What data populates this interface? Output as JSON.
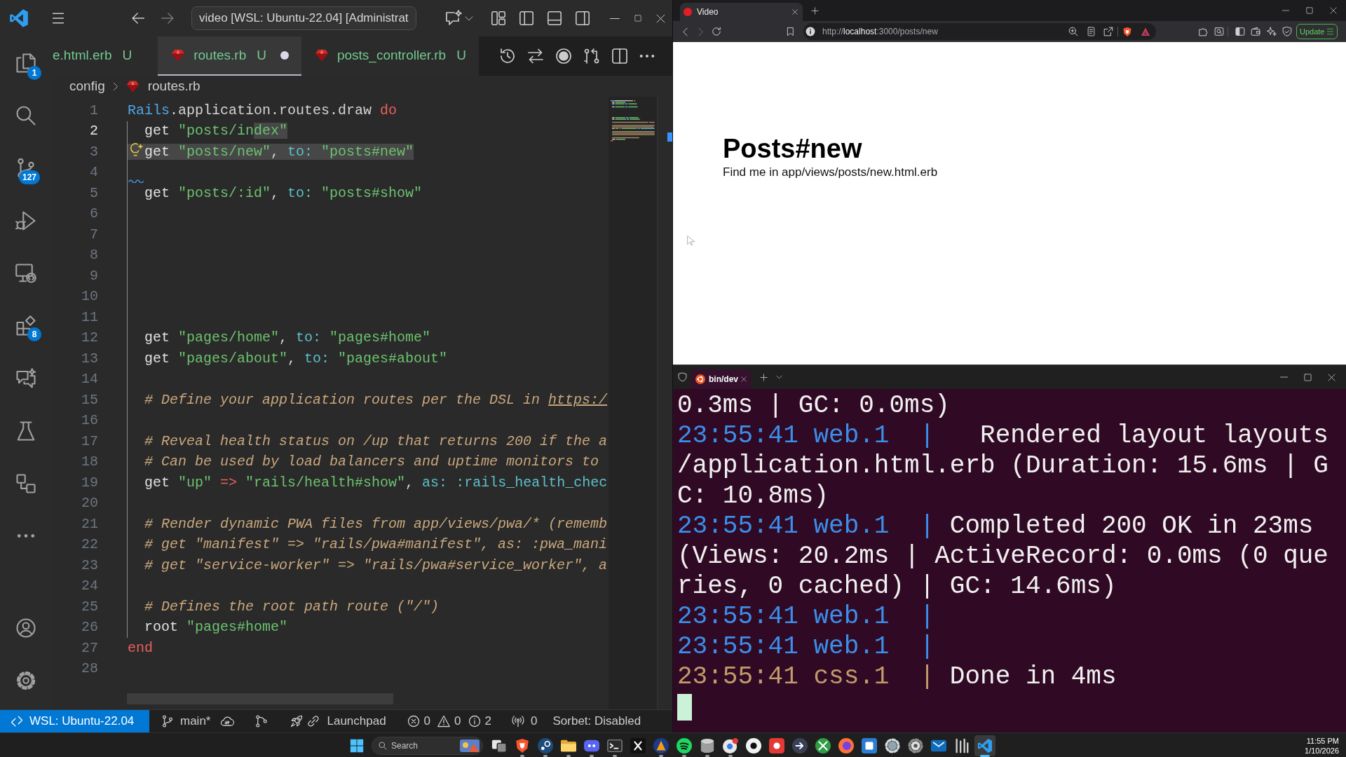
{
  "editor_window": {
    "command_center": "video [WSL: Ubuntu-22.04] [Administrat",
    "activity_bar": {
      "explorer_badge": "1",
      "source_control_badge": "127",
      "extensions_badge": "8"
    },
    "tabs": [
      {
        "label": "e.html.erb",
        "decoration": "U",
        "clipped": true,
        "selected": false,
        "dirty": false
      },
      {
        "label": "routes.rb",
        "decoration": "U",
        "clipped": false,
        "selected": true,
        "dirty": true
      },
      {
        "label": "posts_controller.rb",
        "decoration": "U",
        "clipped": false,
        "selected": false,
        "dirty": false
      }
    ],
    "breadcrumb": [
      {
        "label": "config",
        "kind": "folder"
      },
      {
        "label": "routes.rb",
        "kind": "file"
      }
    ],
    "lines": [
      {
        "number": "1",
        "current": false,
        "tokens": [
          {
            "kind": "constant",
            "text": "Rails",
            "selected": false
          },
          {
            "kind": "method",
            "text": ".application.routes.draw ",
            "selected": false
          },
          {
            "kind": "keyword",
            "text": "do",
            "selected": false
          }
        ]
      },
      {
        "number": "2",
        "current": true,
        "tokens": [
          {
            "kind": "plain",
            "text": "  get ",
            "selected": false
          },
          {
            "kind": "string",
            "text": "\"posts/in",
            "selected": false
          },
          {
            "kind": "string",
            "text": "dex\"",
            "selected": true
          }
        ]
      },
      {
        "number": "3",
        "current": false,
        "marker": {
          "kind": "lightbulb"
        },
        "tokens": [
          {
            "kind": "plain",
            "text": "  get ",
            "selected": true
          },
          {
            "kind": "string",
            "text": "\"posts/new\"",
            "selected": true
          },
          {
            "kind": "punct",
            "text": ", ",
            "selected": true
          },
          {
            "kind": "symbol",
            "text": "to: ",
            "selected": true
          },
          {
            "kind": "string",
            "text": "\"posts#new\"",
            "selected": true
          }
        ]
      },
      {
        "number": "4",
        "current": false,
        "marker": {
          "kind": "squiggle"
        }
      },
      {
        "number": "5",
        "current": false,
        "tokens": [
          {
            "kind": "plain",
            "text": "  get ",
            "selected": false
          },
          {
            "kind": "string",
            "text": "\"posts/:id\"",
            "selected": false
          },
          {
            "kind": "punct",
            "text": ", ",
            "selected": false
          },
          {
            "kind": "symbol",
            "text": "to: ",
            "selected": false
          },
          {
            "kind": "string",
            "text": "\"posts#show\"",
            "selected": false
          }
        ]
      },
      {
        "number": "6",
        "current": false
      },
      {
        "number": "7",
        "current": false
      },
      {
        "number": "8",
        "current": false
      },
      {
        "number": "9",
        "current": false
      },
      {
        "number": "10",
        "current": false
      },
      {
        "number": "11",
        "current": false
      },
      {
        "number": "12",
        "current": false,
        "tokens": [
          {
            "kind": "plain",
            "text": "  get ",
            "selected": false
          },
          {
            "kind": "string",
            "text": "\"pages/home\"",
            "selected": false
          },
          {
            "kind": "punct",
            "text": ", ",
            "selected": false
          },
          {
            "kind": "symbol",
            "text": "to: ",
            "selected": false
          },
          {
            "kind": "string",
            "text": "\"pages#home\"",
            "selected": false
          }
        ]
      },
      {
        "number": "13",
        "current": false,
        "tokens": [
          {
            "kind": "plain",
            "text": "  get ",
            "selected": false
          },
          {
            "kind": "string",
            "text": "\"pages/about\"",
            "selected": false
          },
          {
            "kind": "punct",
            "text": ", ",
            "selected": false
          },
          {
            "kind": "symbol",
            "text": "to: ",
            "selected": false
          },
          {
            "kind": "string",
            "text": "\"pages#about\"",
            "selected": false
          }
        ]
      },
      {
        "number": "14",
        "current": false
      },
      {
        "number": "15",
        "current": false,
        "tokens": [
          {
            "kind": "comment",
            "text": "  # Define your application routes per the DSL in ",
            "selected": false
          },
          {
            "kind": "link",
            "text": "https:/",
            "selected": false
          }
        ]
      },
      {
        "number": "16",
        "current": false
      },
      {
        "number": "17",
        "current": false,
        "tokens": [
          {
            "kind": "comment",
            "text": "  # Reveal health status on /up that returns 200 if the a",
            "selected": false
          }
        ]
      },
      {
        "number": "18",
        "current": false,
        "tokens": [
          {
            "kind": "comment",
            "text": "  # Can be used by load balancers and uptime monitors to",
            "selected": false
          }
        ]
      },
      {
        "number": "19",
        "current": false,
        "tokens": [
          {
            "kind": "plain",
            "text": "  get ",
            "selected": false
          },
          {
            "kind": "string",
            "text": "\"up\"",
            "selected": false
          },
          {
            "kind": "operator",
            "text": " => ",
            "selected": false
          },
          {
            "kind": "string",
            "text": "\"rails/health#show\"",
            "selected": false
          },
          {
            "kind": "punct",
            "text": ", ",
            "selected": false
          },
          {
            "kind": "symbol",
            "text": "as: ",
            "selected": false
          },
          {
            "kind": "symbol",
            "text": ":rails_health_chec",
            "selected": false
          }
        ]
      },
      {
        "number": "20",
        "current": false
      },
      {
        "number": "21",
        "current": false,
        "tokens": [
          {
            "kind": "comment",
            "text": "  # Render dynamic PWA files from app/views/pwa/* (rememb",
            "selected": false
          }
        ]
      },
      {
        "number": "22",
        "current": false,
        "tokens": [
          {
            "kind": "comment",
            "text": "  # get \"manifest\" => \"rails/pwa#manifest\", as: :pwa_mani",
            "selected": false
          }
        ]
      },
      {
        "number": "23",
        "current": false,
        "tokens": [
          {
            "kind": "comment",
            "text": "  # get \"service-worker\" => \"rails/pwa#service_worker\", a",
            "selected": false
          }
        ]
      },
      {
        "number": "24",
        "current": false
      },
      {
        "number": "25",
        "current": false,
        "tokens": [
          {
            "kind": "comment",
            "text": "  # Defines the root path route (\"/\")",
            "selected": false
          }
        ]
      },
      {
        "number": "26",
        "current": false,
        "tokens": [
          {
            "kind": "plain",
            "text": "  root ",
            "selected": false
          },
          {
            "kind": "string",
            "text": "\"pages#home\"",
            "selected": false
          }
        ]
      },
      {
        "number": "27",
        "current": false,
        "tokens": [
          {
            "kind": "keyword",
            "text": "end",
            "selected": false
          }
        ]
      },
      {
        "number": "28",
        "current": false
      }
    ],
    "status_bar": {
      "remote": "WSL: Ubuntu-22.04",
      "branch": "main*",
      "launchpad": "Launchpad",
      "errors": "0",
      "warnings": "0",
      "infos": "2",
      "ports": "0",
      "sorbet": "Sorbet: Disabled"
    }
  },
  "browser_window": {
    "tab_title": "Video",
    "url": {
      "scheme": "http://",
      "host": "localhost",
      "path": ":3000/posts/new"
    },
    "update_button": "Update",
    "page": {
      "heading": "Posts#new",
      "text": "Find me in app/views/posts/new.html.erb"
    }
  },
  "terminal_window": {
    "tab_title": "bin/dev",
    "lines": [
      {
        "kind": "text",
        "text": "0.3ms | GC: 0.0ms)"
      },
      {
        "kind": "log",
        "time": "23:55:41",
        "process": "web.1",
        "separator": "|",
        "color": "#3b8eea",
        "message": "  Rendered layout layouts"
      },
      {
        "kind": "text",
        "text": "/application.html.erb (Duration: 15.6ms | G"
      },
      {
        "kind": "text",
        "text": "C: 10.8ms)"
      },
      {
        "kind": "log",
        "time": "23:55:41",
        "process": "web.1",
        "separator": "|",
        "color": "#3b8eea",
        "message": "Completed 200 OK in 23ms"
      },
      {
        "kind": "text",
        "text": "(Views: 20.2ms | ActiveRecord: 0.0ms (0 que"
      },
      {
        "kind": "text",
        "text": "ries, 0 cached) | GC: 14.6ms)"
      },
      {
        "kind": "log",
        "time": "23:55:41",
        "process": "web.1",
        "separator": "|",
        "color": "#3b8eea"
      },
      {
        "kind": "log",
        "time": "23:55:41",
        "process": "web.1",
        "separator": "|",
        "color": "#3b8eea"
      },
      {
        "kind": "log",
        "time": "23:55:41",
        "process": "css.1",
        "separator": "|",
        "color": "#c39a6b",
        "message": "Done in 4ms"
      },
      {
        "kind": "cursor"
      }
    ]
  },
  "taskbar": {
    "search_placeholder": "Search",
    "apps": [
      {
        "kind": "taskview",
        "running": false,
        "selected": false
      },
      {
        "kind": "shield",
        "running": true,
        "selected": false
      },
      {
        "kind": "disc",
        "running": true,
        "selected": false
      },
      {
        "kind": "folder",
        "running": true,
        "selected": false
      },
      {
        "kind": "bubble",
        "running": true,
        "selected": false
      },
      {
        "kind": "terminal",
        "running": true,
        "selected": false
      },
      {
        "kind": "cross",
        "running": false,
        "selected": false
      },
      {
        "kind": "triangle",
        "running": true,
        "selected": false
      },
      {
        "kind": "waves",
        "running": true,
        "selected": false
      },
      {
        "kind": "database",
        "running": true,
        "selected": false
      },
      {
        "kind": "orb",
        "running": true,
        "selected": false
      },
      {
        "kind": "circle",
        "running": false,
        "selected": false
      },
      {
        "kind": "record",
        "running": false,
        "selected": false
      },
      {
        "kind": "arrow",
        "running": false,
        "selected": false
      },
      {
        "kind": "sphere",
        "running": false,
        "selected": false
      },
      {
        "kind": "globe",
        "running": false,
        "selected": false
      },
      {
        "kind": "tile",
        "running": false,
        "selected": false
      },
      {
        "kind": "cog",
        "running": false,
        "selected": false
      },
      {
        "kind": "gear",
        "running": false,
        "selected": false
      },
      {
        "kind": "mail",
        "running": false,
        "selected": false
      },
      {
        "kind": "bars",
        "running": false,
        "selected": false
      },
      {
        "kind": "ribbon",
        "running": true,
        "selected": true
      }
    ],
    "time": "11:55 PM",
    "date": "1/10/2026"
  }
}
